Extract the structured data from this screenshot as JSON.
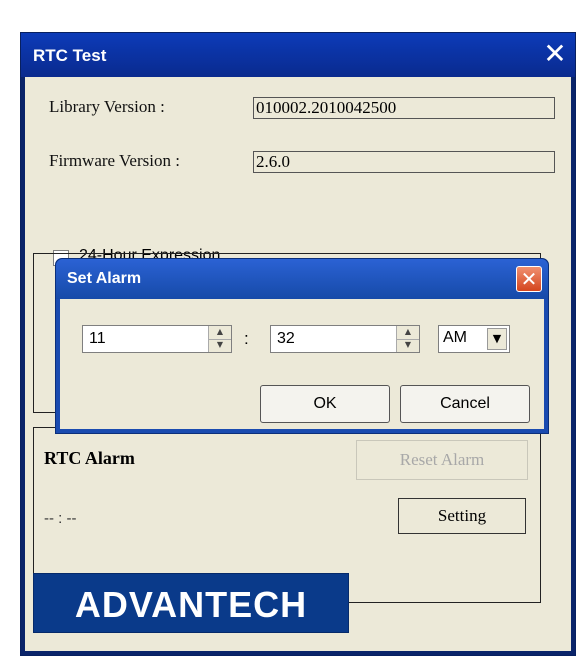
{
  "window": {
    "title": "RTC Test",
    "close_glyph": "✕"
  },
  "fields": {
    "library_label": "Library Version :",
    "library_value": "010002.2010042500",
    "firmware_label": "Firmware Version :",
    "firmware_value": "2.6.0"
  },
  "checkbox": {
    "label": "24-Hour Expression",
    "checked": false
  },
  "alarm": {
    "title": "RTC Alarm",
    "reset_label": "Reset Alarm",
    "setting_label": "Setting",
    "time_text": "-- : --"
  },
  "logo": {
    "text": "ADVANTECH"
  },
  "dialog": {
    "title": "Set Alarm",
    "close_glyph": "✕",
    "hour_value": "11",
    "minute_value": "32",
    "separator": ":",
    "ampm_value": "AM",
    "ok_label": "OK",
    "cancel_label": "Cancel"
  },
  "icons": {
    "spin_up": "▲",
    "spin_down": "▼",
    "dropdown": "▼"
  },
  "colors": {
    "titlebar": "#0a2a8e",
    "dialog_titlebar": "#1a4bb0",
    "close_button": "#d4451e",
    "face": "#ece9d8",
    "logo_bg": "#0a3a8a"
  }
}
